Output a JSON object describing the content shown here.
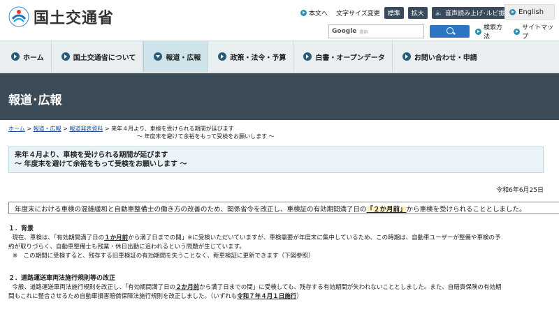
{
  "header": {
    "logo_text": "国土交通省",
    "links": [
      "本文へ",
      "文字サイズ変更"
    ],
    "size_buttons": [
      "標準",
      "拡大"
    ],
    "read_aloud": "音声読み上げ･ルビ振り",
    "english": "English",
    "search_brand": "Google",
    "search_brand_sub": "提供",
    "search_method": "検索方法",
    "sitemap": "サイトマップ"
  },
  "nav": [
    {
      "label": "ホーム"
    },
    {
      "label": "国土交通省について"
    },
    {
      "label": "報道・広報",
      "active": true
    },
    {
      "label": "政策・法令・予算"
    },
    {
      "label": "白書・オープンデータ"
    },
    {
      "label": "お問い合わせ・申請"
    }
  ],
  "banner_title": "報道･広報",
  "breadcrumb": {
    "home": "ホーム",
    "press": "報道・広報",
    "release": "報道発表資料",
    "current_1": "来年４月より、車検を受けられる期間が延びます",
    "current_2": "～ 年度末を避けて余裕をもって受検をお願いします ～"
  },
  "title": {
    "line1": "来年４月より、車検を受けられる期間が延びます",
    "line2": "～ 年度末を避けて余裕をもって受検をお願いします ～"
  },
  "date": "令和6年6月25日",
  "lead": {
    "before": "年度末における車検の混雑緩和と自動車整備士の働き方の改善のため、関係省令を改正し、車検証の有効期間満了日の",
    "highlight": "「２か月前」",
    "after": "から車検を受けられることとしました。"
  },
  "section1": {
    "heading": "１．背景",
    "p1_a": "現在、車検は、「有効期間満了日の",
    "p1_b": "１か月前",
    "p1_c": "から満了日までの間」※に受検いただいていますが、車検需要が年度末に集中しているため、この時期は、自動車ユーザーが整備や車検の予",
    "p1_d": "約が取りづらく、自動車整備士も残業・休日出勤に追われるという問題が生じています。",
    "note": "※　この期間に受検すると、残存する旧車検証の有効期間を失うことなく、新車検証に更新できます（下図参照）"
  },
  "section2": {
    "heading": "２．道路運送車両法施行規則等の改正",
    "p1_a": "今般、道路運送車両法施行規則を改正し、「有効期間満了日の",
    "p1_b": "２か月前",
    "p1_c": "から満了日までの間」に受検しても、残存する有効期間が失われないこととしました。また、自賠責保険の有効期",
    "p1_d": "間もこれに整合させるため自動車損害賠償保障法施行規則を改正しました。（いずれも",
    "p1_e": "令和７年４月１日施行",
    "p1_f": "）"
  }
}
